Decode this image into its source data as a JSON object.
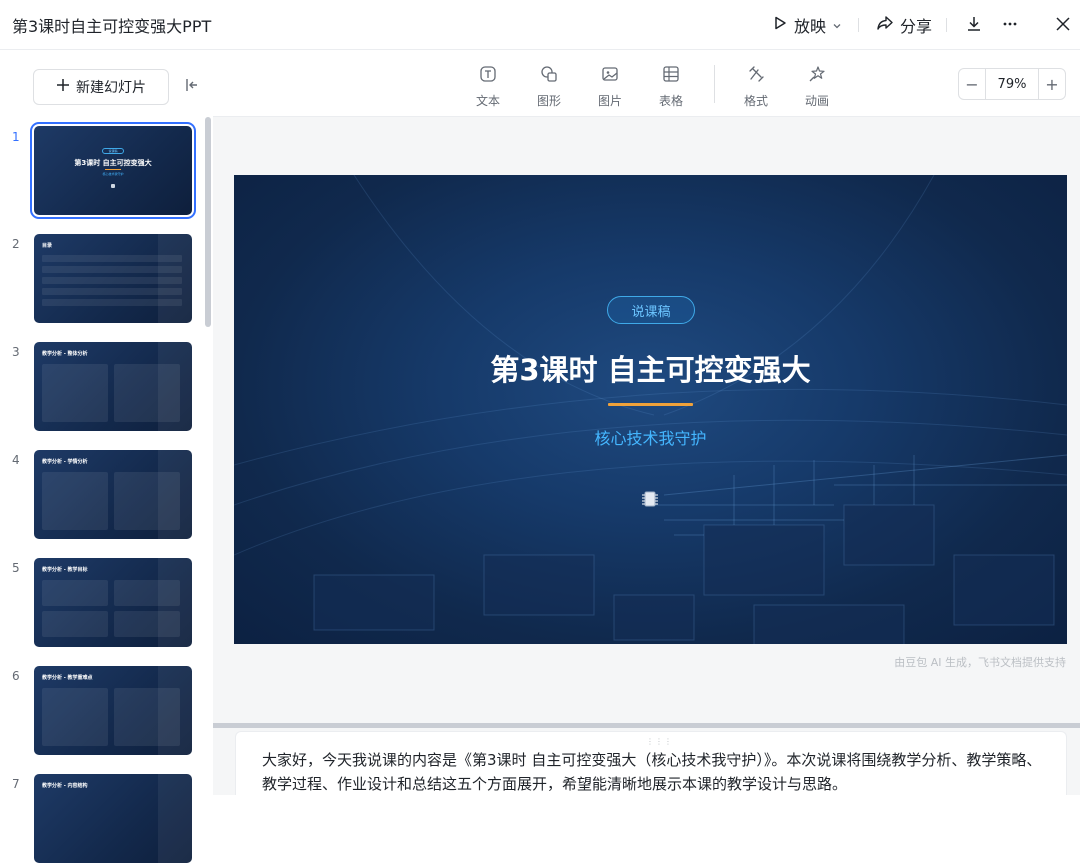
{
  "document": {
    "title": "第3课时自主可控变强大PPT"
  },
  "titlebar": {
    "play_label": "放映",
    "share_label": "分享",
    "icons": [
      "play-icon",
      "chevron-down-icon",
      "share-icon",
      "download-icon",
      "more-icon",
      "close-icon"
    ]
  },
  "sidebar": {
    "new_slide_label": "新建幻灯片",
    "thumbnails": [
      {
        "number": "1",
        "tag": "说课稿",
        "title": "第3课时 自主可控变强大",
        "subtitle": "核心技术我守护"
      },
      {
        "number": "2",
        "title": "目录"
      },
      {
        "number": "3",
        "title": "教学分析 - 整体分析"
      },
      {
        "number": "4",
        "title": "教学分析 - 学情分析"
      },
      {
        "number": "5",
        "title": "教学分析 - 教学目标"
      },
      {
        "number": "6",
        "title": "教学分析 - 教学重难点"
      },
      {
        "number": "7",
        "title": "教学分析 - 内容结构"
      }
    ],
    "active_index": 1
  },
  "toolbar": {
    "tools": [
      {
        "label": "文本",
        "icon": "text-icon"
      },
      {
        "label": "图形",
        "icon": "shape-icon"
      },
      {
        "label": "图片",
        "icon": "image-icon"
      },
      {
        "label": "表格",
        "icon": "table-icon"
      },
      {
        "label": "格式",
        "icon": "format-icon"
      },
      {
        "label": "动画",
        "icon": "animation-icon"
      }
    ],
    "zoom": {
      "value": "79%",
      "minus": "−",
      "plus": "+"
    }
  },
  "slide": {
    "tag": "说课稿",
    "title": "第3课时 自主可控变强大",
    "subtitle": "核心技术我守护",
    "accent_color": "#f0a23a",
    "subtitle_color": "#44b6ff"
  },
  "credit": "由豆包 AI 生成，飞书文档提供支持",
  "notes": {
    "text": "大家好，今天我说课的内容是《第3课时 自主可控变强大（核心技术我守护）》。本次说课将围绕教学分析、教学策略、教学过程、作业设计和总结这五个方面展开，希望能清晰地展示本课的教学设计与思路。"
  }
}
